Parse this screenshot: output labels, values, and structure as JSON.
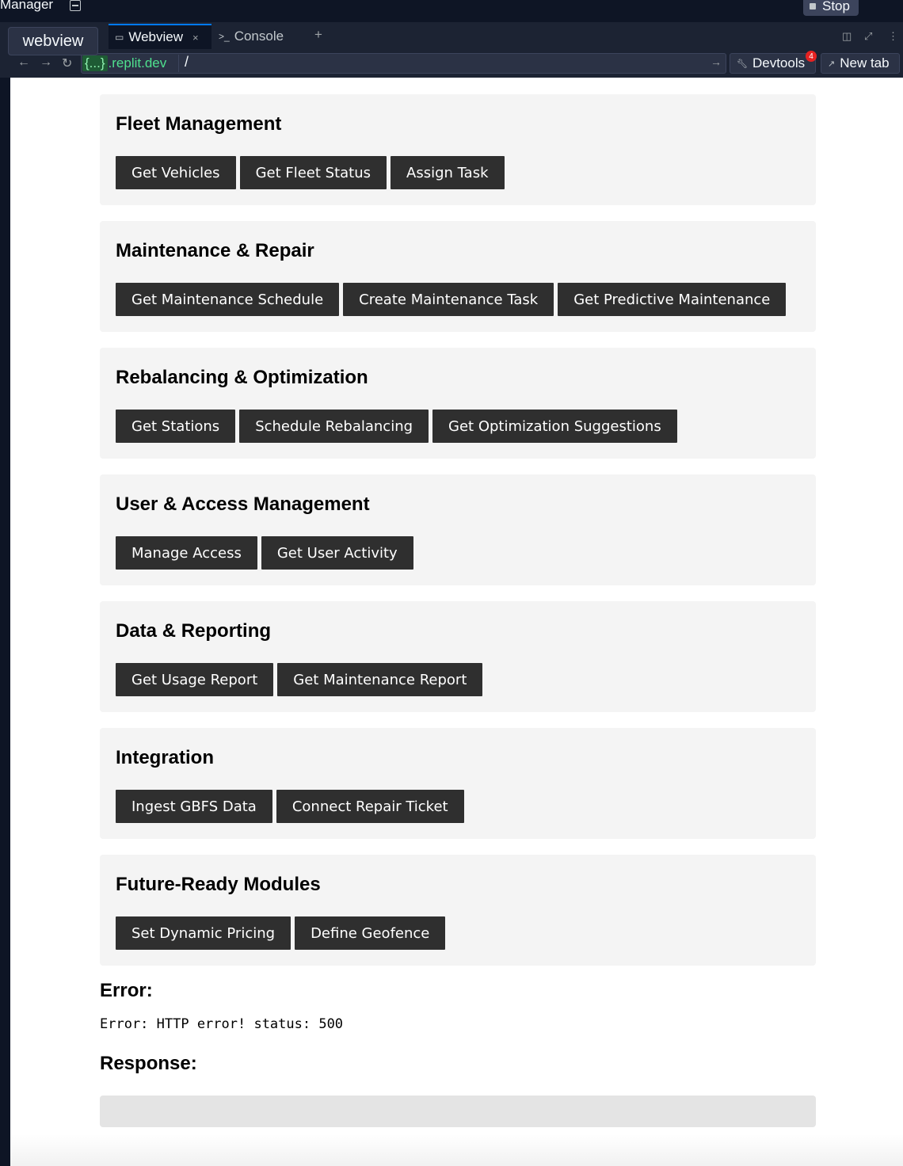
{
  "topbar": {
    "app_title": "Manager",
    "stop_label": "Stop"
  },
  "tabs": {
    "tooltip": "webview",
    "items": [
      {
        "label": "Webview",
        "icon": "monitor-icon",
        "active": true
      },
      {
        "label": "Console",
        "icon": "terminal-icon",
        "active": false
      }
    ],
    "plus": "+"
  },
  "address": {
    "host_tag": "{...}",
    "host": ".replit.dev",
    "path": "/",
    "devtools_label": "Devtools",
    "devtools_badge": "4",
    "newtab_label": "New tab"
  },
  "sections": [
    {
      "title": "Fleet Management",
      "buttons": [
        "Get Vehicles",
        "Get Fleet Status",
        "Assign Task"
      ]
    },
    {
      "title": "Maintenance & Repair",
      "buttons": [
        "Get Maintenance Schedule",
        "Create Maintenance Task",
        "Get Predictive Maintenance"
      ]
    },
    {
      "title": "Rebalancing & Optimization",
      "buttons": [
        "Get Stations",
        "Schedule Rebalancing",
        "Get Optimization Suggestions"
      ]
    },
    {
      "title": "User & Access Management",
      "buttons": [
        "Manage Access",
        "Get User Activity"
      ]
    },
    {
      "title": "Data & Reporting",
      "buttons": [
        "Get Usage Report",
        "Get Maintenance Report"
      ]
    },
    {
      "title": "Integration",
      "buttons": [
        "Ingest GBFS Data",
        "Connect Repair Ticket"
      ]
    },
    {
      "title": "Future-Ready Modules",
      "buttons": [
        "Set Dynamic Pricing",
        "Define Geofence"
      ]
    }
  ],
  "error": {
    "heading": "Error:",
    "message": "Error: HTTP error! status: 500"
  },
  "response": {
    "heading": "Response:",
    "body": ""
  }
}
